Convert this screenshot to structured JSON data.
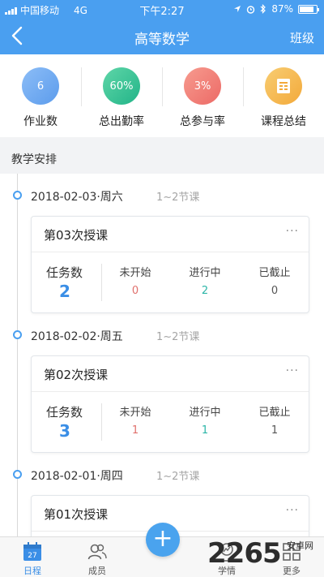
{
  "status_bar": {
    "carrier": "中国移动",
    "network": "4G",
    "time": "下午2:27",
    "battery": "87%"
  },
  "nav": {
    "title": "高等数学",
    "right_label": "班级"
  },
  "stats": [
    {
      "value": "6",
      "label": "作业数",
      "color": "#6aa8f2"
    },
    {
      "value": "60%",
      "label": "总出勤率",
      "color": "#36c29a"
    },
    {
      "value": "3%",
      "label": "总参与率",
      "color": "#f07a76"
    },
    {
      "value": "",
      "label": "课程总结",
      "color": "#f5b94a"
    }
  ],
  "section_title": "教学安排",
  "sessions": [
    {
      "date": "2018-02-03·周六",
      "period": "1~2节课",
      "title": "第03次授课",
      "task_label": "任务数",
      "task_count": "2",
      "status": [
        {
          "label": "未开始",
          "value": "0"
        },
        {
          "label": "进行中",
          "value": "2"
        },
        {
          "label": "已截止",
          "value": "0"
        }
      ]
    },
    {
      "date": "2018-02-02·周五",
      "period": "1~2节课",
      "title": "第02次授课",
      "task_label": "任务数",
      "task_count": "3",
      "status": [
        {
          "label": "未开始",
          "value": "1"
        },
        {
          "label": "进行中",
          "value": "1"
        },
        {
          "label": "已截止",
          "value": "1"
        }
      ]
    },
    {
      "date": "2018-02-01·周四",
      "period": "1~2节课",
      "title": "第01次授课"
    }
  ],
  "more_glyph": "···",
  "fab_glyph": "+",
  "tabs": [
    {
      "label": "日程",
      "icon": "calendar-icon",
      "icon_text": "27"
    },
    {
      "label": "成员",
      "icon": "members-icon"
    },
    {
      "label": "学情",
      "icon": "learning-icon"
    },
    {
      "label": "更多",
      "icon": "more-grid-icon"
    }
  ],
  "watermark": {
    "text": "2265",
    "site": "安卓网"
  },
  "colors": {
    "primary": "#4a9ff0",
    "not_started": "#e0706c",
    "in_progress": "#2bb5a7",
    "ended": "#555555"
  }
}
